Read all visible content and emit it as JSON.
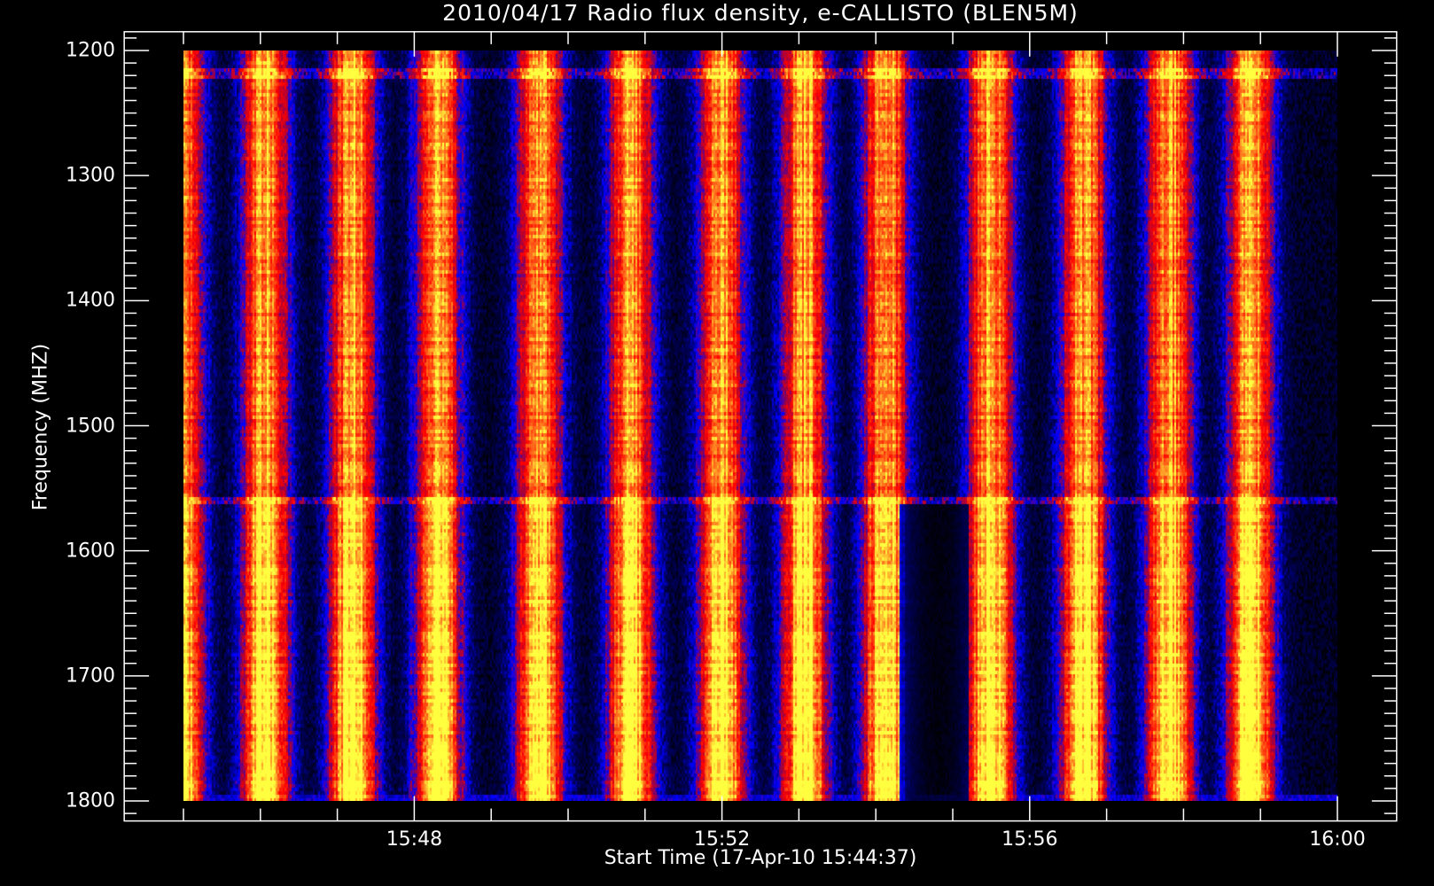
{
  "chart_data": {
    "type": "heatmap",
    "title": "2010/04/17  Radio flux density, e-CALLISTO (BLEN5M)",
    "xlabel": "Start Time (17-Apr-10 15:44:37)",
    "ylabel": "Frequency (MHZ)",
    "x_unit": "minutes after 15:45:00",
    "xlim_minutes": [
      -0.77,
      15.77
    ],
    "data_x_range_minutes": [
      0,
      15
    ],
    "ylim": [
      1816,
      1185
    ],
    "data_y_range": [
      1200,
      1800
    ],
    "x_ticks": [
      {
        "minute": 3,
        "label": "15:48"
      },
      {
        "minute": 7,
        "label": "15:52"
      },
      {
        "minute": 11,
        "label": "15:56"
      },
      {
        "minute": 15,
        "label": "16:00"
      }
    ],
    "x_minor_tick_step_minutes": 1,
    "y_ticks": [
      {
        "value": 1200,
        "label": "1200"
      },
      {
        "value": 1300,
        "label": "1300"
      },
      {
        "value": 1400,
        "label": "1400"
      },
      {
        "value": 1500,
        "label": "1500"
      },
      {
        "value": 1600,
        "label": "1600"
      },
      {
        "value": 1700,
        "label": "1700"
      },
      {
        "value": 1800,
        "label": "1800"
      }
    ],
    "y_minor_tick_step": 10,
    "burst_band_centers_minutes": [
      -0.05,
      1.06,
      2.19,
      3.3,
      4.62,
      5.81,
      6.98,
      8.07,
      9.12,
      10.48,
      11.69,
      12.81,
      13.86
    ],
    "interference_lines_mhz": [
      1217,
      1558
    ],
    "brighter_below_mhz": 1560,
    "colormap": [
      "#000000",
      "#000060",
      "#0000ff",
      "#a00040",
      "#ff0000",
      "#ff8020",
      "#ffff40"
    ],
    "grid": false
  }
}
